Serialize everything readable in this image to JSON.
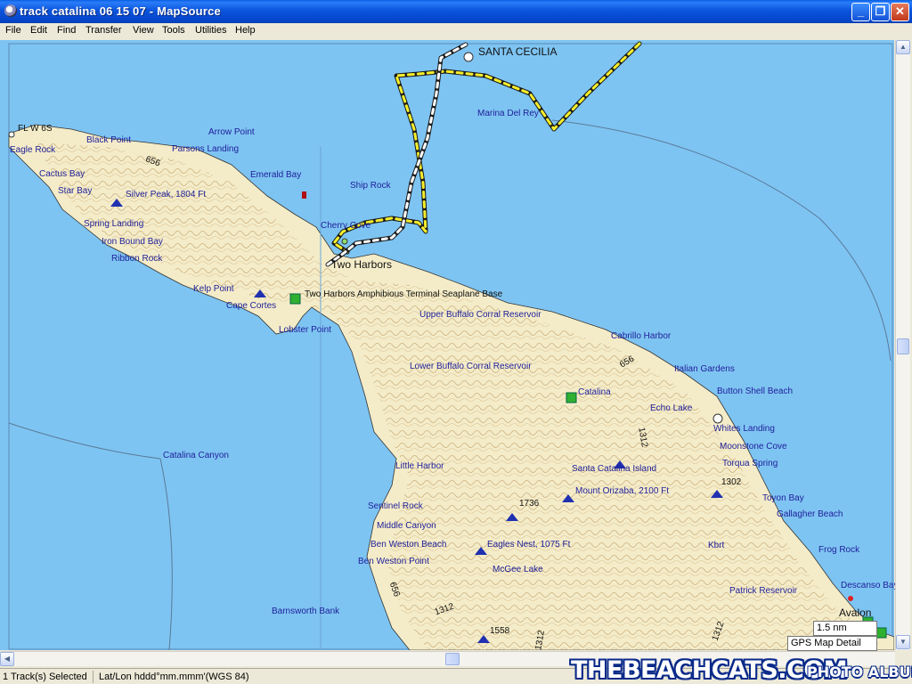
{
  "window": {
    "title": "track catalina 06 15 07 - MapSource",
    "minimize": "_",
    "restore": "❐",
    "close": "✕"
  },
  "menu": [
    "File",
    "Edit",
    "Find",
    "Transfer",
    "View",
    "Tools",
    "Utilities",
    "Help"
  ],
  "colors": {
    "water": "#7ec4f2",
    "land": "#f4ecc8",
    "contour": "#b89a6a",
    "label": "#1e1e9a",
    "track_yellow": "#f6ef2c",
    "track_white": "#ffffff"
  },
  "map": {
    "big_labels": [
      "SANTA CECILIA",
      "Two Harbors"
    ],
    "place_labels": [
      "FL W 6S",
      "Eagle Rock",
      "Black Point",
      "Arrow Point",
      "Parsons Landing",
      "Cactus Bay",
      "Emerald Bay",
      "Star Bay",
      "Silver Peak, 1804 Ft",
      "Ship Rock",
      "Spring Landing",
      "Iron Bound Bay",
      "Ribbon Rock",
      "Cherry Cove",
      "Kelp Point",
      "Two Harbors Amphibious Terminal Seaplane Base",
      "Cape Cortes",
      "Lobster Point",
      "Marina Del Rey",
      "Upper Buffalo Corral Reservoir",
      "Cabrillo Harbor",
      "Lower Buffalo Corral Reservoir",
      "Italian Gardens",
      "Catalina",
      "Button Shell Beach",
      "Echo Lake",
      "Whites Landing",
      "Moonstone Cove",
      "Catalina Canyon",
      "Little Harbor",
      "Santa Catalina Island",
      "Torqua Spring",
      "Mount Orizaba, 2100 Ft",
      "Toyon Bay",
      "Gallagher Beach",
      "Sentinel Rock",
      "Middle Canyon",
      "Ben Weston Beach",
      "Eagles Nest, 1075 Ft",
      "Frog Rock",
      "Ben Weston Point",
      "McGee Lake",
      "Kbrt",
      "Descanso Bay",
      "Patrick Reservoir",
      "Avalon",
      "Barnsworth Bank"
    ],
    "contour_labels": [
      "656",
      "656",
      "1312",
      "1302",
      "1736",
      "656",
      "1312",
      "1558",
      "1312",
      "1312"
    ]
  },
  "overlay": {
    "scale": "1.5 nm",
    "detail": "GPS Map Detail"
  },
  "status": {
    "selection": "1 Track(s) Selected",
    "position_format": "Lat/Lon hddd°mm.mmm'(WGS 84)"
  },
  "watermark": {
    "main": "THEBEACHCATS.COM",
    "sub": "PHOTO ALBUMS"
  }
}
